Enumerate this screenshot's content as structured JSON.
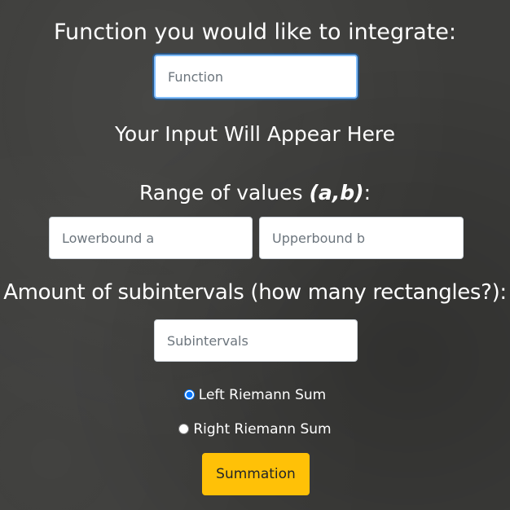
{
  "function_section": {
    "heading": "Function you would like to integrate:",
    "input_placeholder": "Function",
    "input_value": ""
  },
  "preview": {
    "text": "Your Input Will Appear Here"
  },
  "range_section": {
    "heading_prefix": "Range of values ",
    "heading_emphasis": "(a,b)",
    "heading_suffix": ":",
    "lower_placeholder": "Lowerbound a",
    "upper_placeholder": "Upperbound b"
  },
  "subintervals_section": {
    "heading": "Amount of subintervals (how many rectangles?):",
    "input_placeholder": "Subintervals"
  },
  "method": {
    "options": [
      {
        "label": "Left Riemann Sum",
        "selected": true
      },
      {
        "label": "Right Riemann Sum",
        "selected": false
      }
    ]
  },
  "submit": {
    "label": "Summation"
  },
  "colors": {
    "background": "#3c3c3a",
    "text": "#ffffff",
    "button": "#ffc107",
    "focus_border": "#80bdff"
  }
}
